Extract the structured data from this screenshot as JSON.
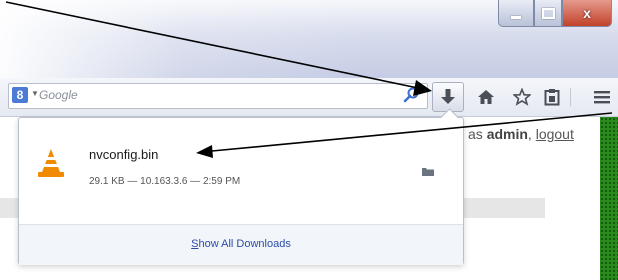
{
  "window": {
    "controls": {
      "minimize": "–",
      "maximize": "□",
      "close": "x"
    }
  },
  "toolbar": {
    "search": {
      "engine_icon": "8",
      "placeholder": "Google"
    },
    "icons": [
      "search-go-icon",
      "download-icon",
      "home-icon",
      "star-icon",
      "clipboard-icon",
      "hamburger-menu-icon"
    ]
  },
  "page": {
    "login_prefix": "as ",
    "login_user": "admin",
    "separator": ", ",
    "logout": "logout"
  },
  "downloads": {
    "file_name": "nvconfig.bin",
    "file_meta": "29.1 KB — 10.163.3.6 — 2:59 PM",
    "show_all_first": "S",
    "show_all_rest": "how All Downloads"
  },
  "colors": {
    "accent_blue": "#2b4da8",
    "green_strip": "#2a8a1c",
    "close_button": "#c2422b",
    "vlc_orange": "#f08a00"
  }
}
